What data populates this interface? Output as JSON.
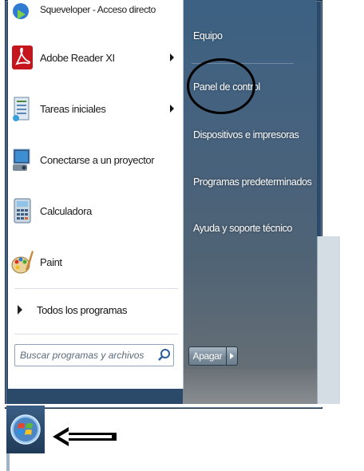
{
  "left_menu": {
    "items": [
      {
        "label": "Squeveloper - Acceso directo",
        "icon": "app-shortcut-icon",
        "has_submenu": false
      },
      {
        "label": "Adobe Reader XI",
        "icon": "adobe-reader-icon",
        "has_submenu": true
      },
      {
        "label": "Tareas iniciales",
        "icon": "getting-started-icon",
        "has_submenu": true
      },
      {
        "label": "Conectarse a un proyector",
        "icon": "projector-icon",
        "has_submenu": false
      },
      {
        "label": "Calculadora",
        "icon": "calculator-icon",
        "has_submenu": false
      },
      {
        "label": "Paint",
        "icon": "paint-icon",
        "has_submenu": false
      }
    ],
    "all_programs": "Todos los programas",
    "search_placeholder": "Buscar programas y archivos"
  },
  "right_menu": {
    "items": [
      {
        "label": "Equipo"
      },
      {
        "label": "Panel de control"
      },
      {
        "label": "Dispositivos e impresoras"
      },
      {
        "label": "Programas predeterminados"
      },
      {
        "label": "Ayuda y soporte técnico"
      }
    ],
    "shutdown_label": "Apagar"
  },
  "colors": {
    "right_pane": "#46627e",
    "annotation": "#000000"
  }
}
